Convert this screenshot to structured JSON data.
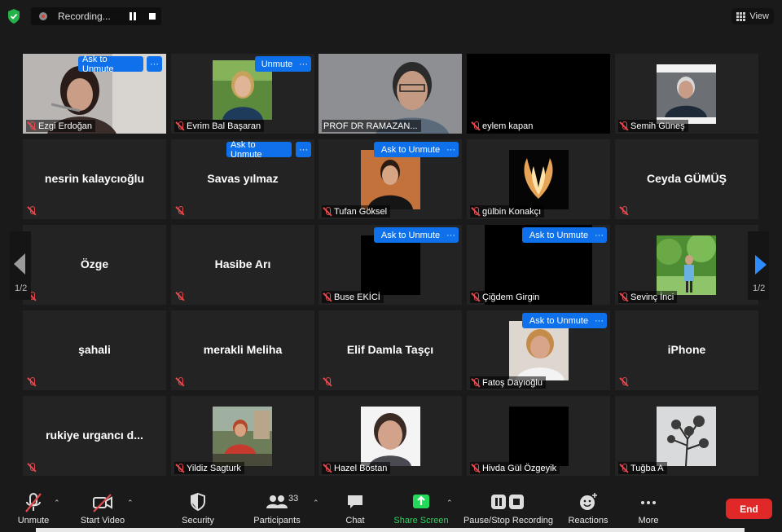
{
  "topbar": {
    "recording_label": "Recording...",
    "view_label": "View"
  },
  "pager": {
    "left": "1/2",
    "right": "1/2"
  },
  "tiles": [
    {
      "name": "Ezgi Erdoğan",
      "button": "Ask to Unmute"
    },
    {
      "name": "Evrim Bal Başaran",
      "button": "Unmute"
    },
    {
      "name": "PROF DR RAMAZAN..."
    },
    {
      "name": "eylem kapan"
    },
    {
      "name": "Semih Güneş"
    },
    {
      "name": "nesrin kalaycıoğlu"
    },
    {
      "name": "Savas yılmaz",
      "button": "Ask to Unmute"
    },
    {
      "name": "Tufan Göksel",
      "button": "Ask to Unmute"
    },
    {
      "name": "gülbin Konakçı"
    },
    {
      "name": "Ceyda GÜMÜŞ"
    },
    {
      "name": "Özge"
    },
    {
      "name": "Hasibe Arı"
    },
    {
      "name": "Buse EKİCİ",
      "button": "Ask to Unmute"
    },
    {
      "name": "Çiğdem Girgin",
      "button": "Ask to Unmute"
    },
    {
      "name": "Sevinç İnci"
    },
    {
      "name": "şahali"
    },
    {
      "name": "merakli Meliha"
    },
    {
      "name": "Elif Damla Taşçı"
    },
    {
      "name": "Fatoş Dayıoğlu",
      "button": "Ask to Unmute"
    },
    {
      "name": "iPhone"
    },
    {
      "name": "rukiye urgancı d..."
    },
    {
      "name": "Yildiz Sagturk"
    },
    {
      "name": "Hazel Bostan"
    },
    {
      "name": "Hivda Gül Özgeyik"
    },
    {
      "name": "Tuğba A"
    }
  ],
  "more_label": "···",
  "toolbar": {
    "unmute": "Unmute",
    "start_video": "Start Video",
    "security": "Security",
    "participants": "Participants",
    "participants_count": "33",
    "chat": "Chat",
    "share_screen": "Share Screen",
    "pause_stop_recording": "Pause/Stop Recording",
    "reactions": "Reactions",
    "more": "More",
    "end": "End"
  },
  "colors": {
    "accent_blue": "#0e71eb",
    "active_speaker": "#c7e15e",
    "share_green": "#23d959",
    "end_red": "#e02828",
    "muted_red": "#e5484d"
  }
}
